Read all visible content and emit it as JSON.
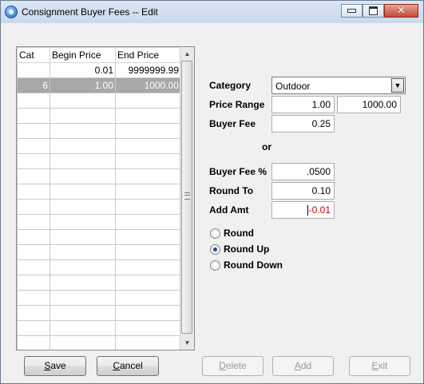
{
  "window": {
    "title": "Consignment Buyer Fees -- Edit",
    "minimize": "_",
    "maximize": "□",
    "close": "✕"
  },
  "grid": {
    "columns": [
      "Cat",
      "Begin Price",
      "End Price"
    ],
    "rows": [
      {
        "cat": "",
        "begin": "0.01",
        "end": "9999999.99"
      },
      {
        "cat": "6",
        "begin": "1.00",
        "end": "1000.00"
      }
    ],
    "selected_row": 1,
    "scroll_up": "▲",
    "scroll_down": "▼"
  },
  "form": {
    "category_label": "Category",
    "category_value": "Outdoor",
    "price_range_label": "Price Range",
    "price_from": "1.00",
    "price_to": "1000.00",
    "buyer_fee_label": "Buyer Fee",
    "buyer_fee": "0.25",
    "or_label": "or",
    "buyer_fee_pct_label": "Buyer Fee %",
    "buyer_fee_pct": ".0500",
    "round_to_label": "Round To",
    "round_to": "0.10",
    "add_amt_label": "Add Amt",
    "add_amt": "-0.01",
    "rounding": [
      {
        "label": "Round",
        "checked": false
      },
      {
        "label": "Round Up",
        "checked": true
      },
      {
        "label": "Round Down",
        "checked": false
      }
    ]
  },
  "buttons": {
    "save": "Save",
    "cancel": "Cancel",
    "delete": "Delete",
    "add": "Add",
    "exit": "Exit"
  },
  "colors": {
    "selected_row_bg": "#a8a8a8",
    "negative_value": "#c00000"
  }
}
